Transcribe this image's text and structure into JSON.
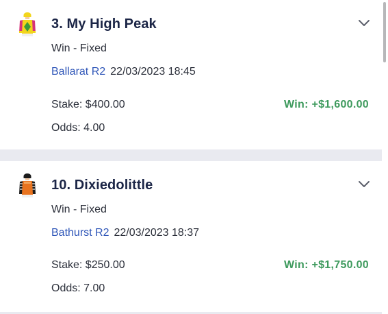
{
  "bets": [
    {
      "runner": "3. My High Peak",
      "silk_icon": "jockey-silk-yellow-green-diamond",
      "bet_type": "Win - Fixed",
      "race": "Ballarat R2",
      "datetime": "22/03/2023 18:45",
      "stake": "Stake: $400.00",
      "odds": "Odds: 4.00",
      "win": "Win: +$1,600.00"
    },
    {
      "runner": "10. Dixiedolittle",
      "silk_icon": "jockey-silk-orange-black",
      "bet_type": "Win - Fixed",
      "race": "Bathurst R2",
      "datetime": "22/03/2023 18:37",
      "stake": "Stake: $250.00",
      "odds": "Odds: 7.00",
      "win": "Win: +$1,750.00"
    }
  ],
  "colors": {
    "win_green": "#3e9a5d",
    "race_link_blue": "#2f56b8",
    "title_navy": "#1b2546",
    "background": "#e9eaf0"
  },
  "icons": {
    "expand": "chevron-down-icon"
  }
}
